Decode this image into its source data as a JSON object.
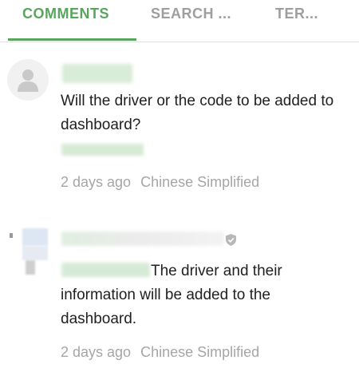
{
  "tabs": [
    {
      "label": "COMMENTS",
      "active": true
    },
    {
      "label": "SEARCH ...",
      "active": false
    },
    {
      "label": "TER...",
      "active": false
    }
  ],
  "comments": [
    {
      "avatar": "default-user-icon",
      "body": "Will the driver or the code to be added to dashboard?",
      "time": "2 days ago",
      "language": "Chinese Simplified"
    },
    {
      "avatar": "user-avatar",
      "verified_icon": "shield-check-icon",
      "body": "The driver and their information will be added to the dashboard.",
      "time": "2 days ago",
      "language": "Chinese Simplified"
    }
  ],
  "colors": {
    "accent": "#5aa55e",
    "muted": "#a6a6a6",
    "text": "#212121"
  }
}
